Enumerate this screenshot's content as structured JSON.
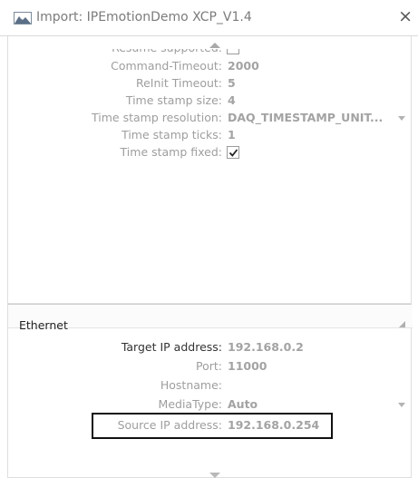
{
  "window": {
    "title": "Import: IPEmotionDemo XCP_V1.4",
    "close_symbol": "×",
    "app_icon": "mountain-image-icon"
  },
  "general": {
    "partial_row_label": "Resume supported:",
    "rows": [
      {
        "label": "Command-Timeout:",
        "value": "2000"
      },
      {
        "label": "ReInit Timeout:",
        "value": "5"
      },
      {
        "label": "Time stamp size:",
        "value": "4"
      },
      {
        "label": "Time stamp resolution:",
        "value": "DAQ_TIMESTAMP_UNIT..."
      },
      {
        "label": "Time stamp ticks:",
        "value": "1"
      },
      {
        "label": "Time stamp fixed:",
        "checked": true
      }
    ]
  },
  "ethernet": {
    "title": "Ethernet",
    "rows": [
      {
        "label": "Target IP address:",
        "value": "192.168.0.2"
      },
      {
        "label": "Port:",
        "value": "11000"
      },
      {
        "label": "Hostname:",
        "value": ""
      },
      {
        "label": "MediaType:",
        "value": "Auto"
      },
      {
        "label": "Source IP address:",
        "value": "192.168.0.254"
      }
    ]
  },
  "colors": {
    "label_gray": "#9e9e9e",
    "value_gray": "#a3a3a3",
    "highlight_border": "#111111"
  }
}
